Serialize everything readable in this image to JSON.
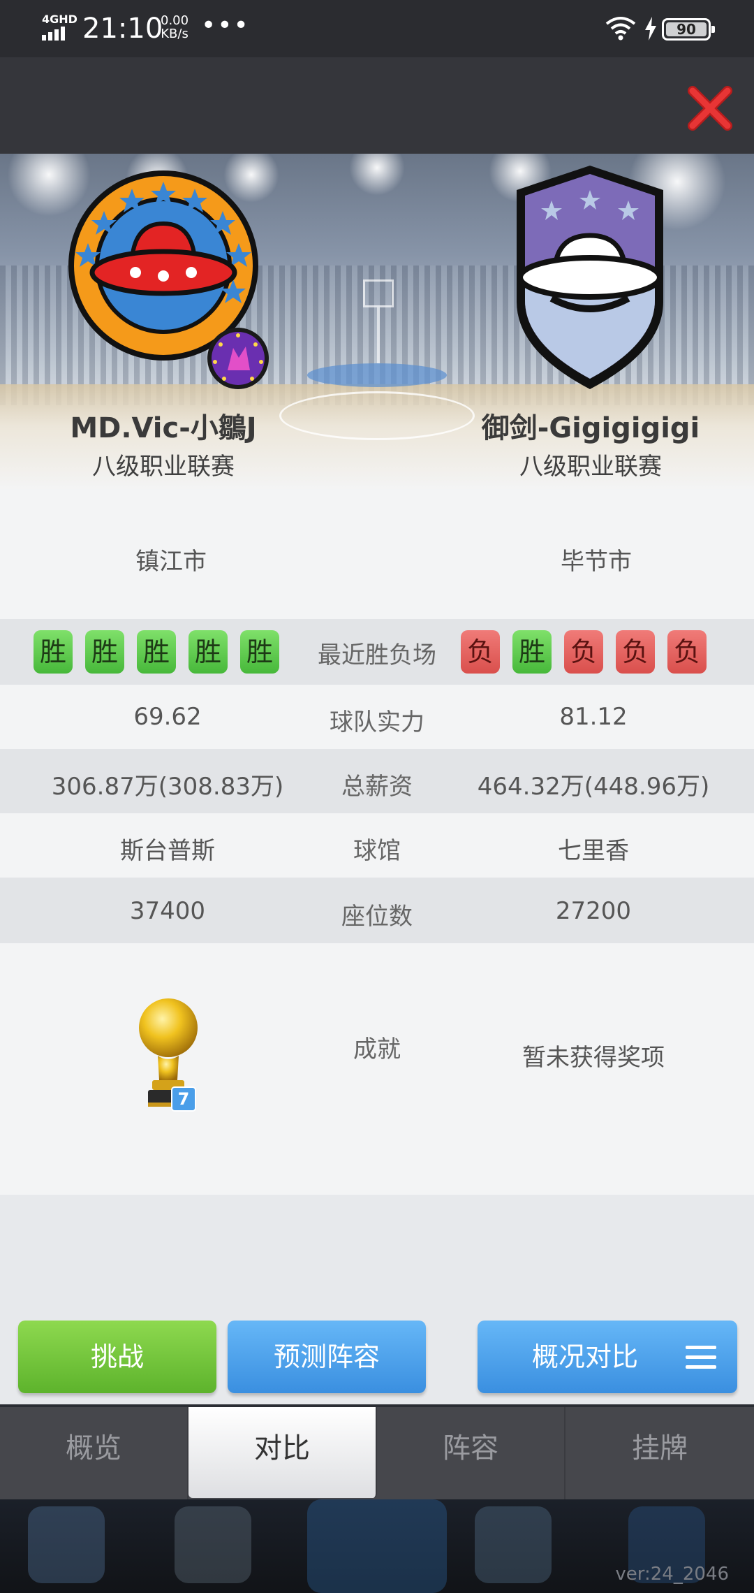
{
  "status_bar": {
    "network": "4GHD",
    "time": "21:10",
    "speed_value": "0.00",
    "speed_unit": "KB/s",
    "more": "•••",
    "battery": "90"
  },
  "header": {
    "close_icon": "close-x-icon"
  },
  "teams": {
    "left": {
      "name": "MD.Vic-小鶵J",
      "league": "八级职业联赛",
      "logo": "ufo-circle-logo"
    },
    "right": {
      "name": "御剑-Gigigigigi",
      "league": "八级职业联赛",
      "logo": "ufo-shield-logo"
    }
  },
  "compare": {
    "city": {
      "left": "镇江市",
      "right": "毕节市"
    },
    "recent": {
      "label": "最近胜负场",
      "left": [
        "胜",
        "胜",
        "胜",
        "胜",
        "胜"
      ],
      "right": [
        "负",
        "胜",
        "负",
        "负",
        "负"
      ]
    },
    "strength": {
      "label": "球队实力",
      "left": "69.62",
      "right": "81.12"
    },
    "salary": {
      "label": "总薪资",
      "left": "306.87万(308.83万)",
      "right": "464.32万(448.96万)"
    },
    "arena": {
      "label": "球馆",
      "left": "斯台普斯",
      "right": "七里香"
    },
    "seats": {
      "label": "座位数",
      "left": "37400",
      "right": "27200"
    },
    "achievement": {
      "label": "成就",
      "left_badge": "7",
      "right": "暂未获得奖项"
    }
  },
  "actions": {
    "challenge": "挑战",
    "predict": "预测阵容",
    "overview_compare": "概况对比"
  },
  "tabs": [
    "概览",
    "对比",
    "阵容",
    "挂牌"
  ],
  "active_tab": "对比",
  "version": "ver:24_2046",
  "colors": {
    "win": "#5cc94a",
    "loss": "#e0605d",
    "green_button": "#6cc13a",
    "blue_button": "#4a9ee9",
    "close_red": "#e02a2a"
  }
}
